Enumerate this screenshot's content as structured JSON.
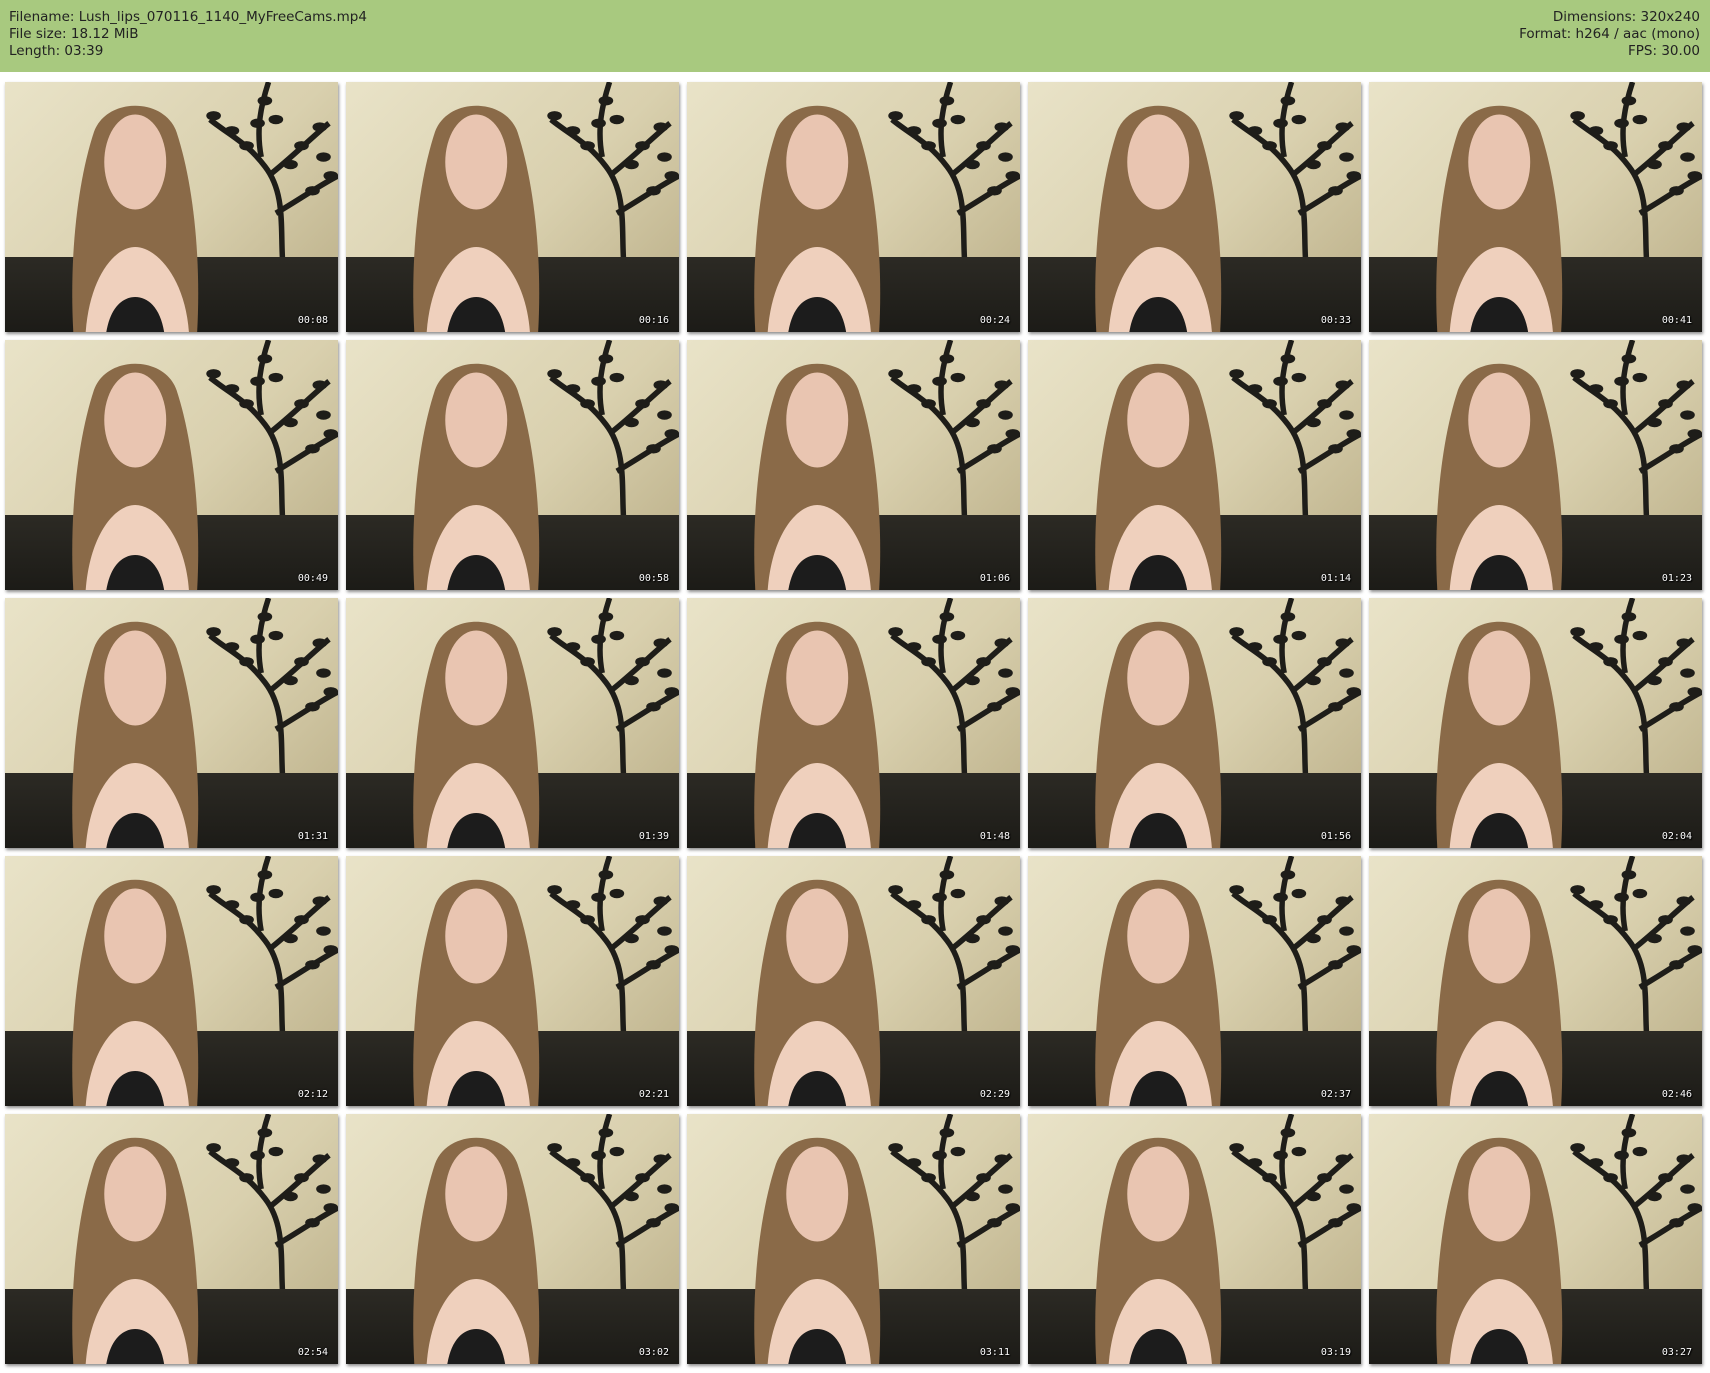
{
  "header": {
    "filename": "Filename: Lush_lips_070116_1140_MyFreeCams.mp4",
    "filesize": "File size: 18.12 MiB",
    "length": "Length: 03:39",
    "dimensions": "Dimensions: 320x240",
    "format": "Format: h264 / aac (mono)",
    "fps": "FPS: 30.00"
  },
  "colors": {
    "header_bg": "#a8c97f",
    "page_bg": "#ffffff"
  },
  "thumbnails": [
    {
      "time": "00:08"
    },
    {
      "time": "00:16"
    },
    {
      "time": "00:24"
    },
    {
      "time": "00:33"
    },
    {
      "time": "00:41"
    },
    {
      "time": "00:49"
    },
    {
      "time": "00:58"
    },
    {
      "time": "01:06"
    },
    {
      "time": "01:14"
    },
    {
      "time": "01:23"
    },
    {
      "time": "01:31"
    },
    {
      "time": "01:39"
    },
    {
      "time": "01:48"
    },
    {
      "time": "01:56"
    },
    {
      "time": "02:04"
    },
    {
      "time": "02:12"
    },
    {
      "time": "02:21"
    },
    {
      "time": "02:29"
    },
    {
      "time": "02:37"
    },
    {
      "time": "02:46"
    },
    {
      "time": "02:54"
    },
    {
      "time": "03:02"
    },
    {
      "time": "03:11"
    },
    {
      "time": "03:19"
    },
    {
      "time": "03:27"
    }
  ]
}
